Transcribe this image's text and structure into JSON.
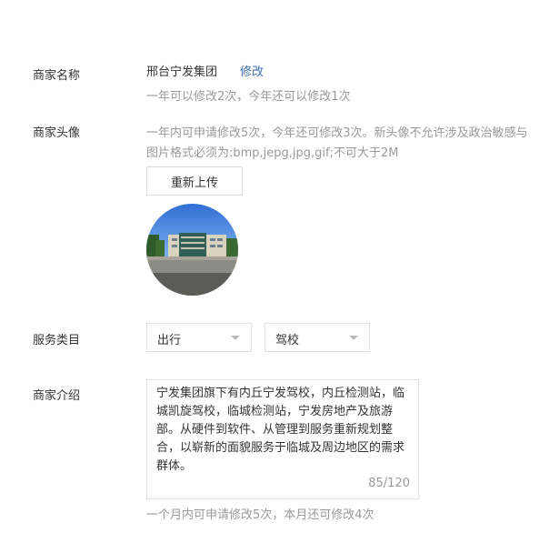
{
  "merchant_name": {
    "label": "商家名称",
    "value": "邢台宁发集团",
    "edit_label": "修改",
    "hint": "一年可以修改2次，今年还可以修改1次"
  },
  "merchant_avatar": {
    "label": "商家头像",
    "hint_line1": "一年内可申请修改5次，今年还可修改3次。新头像不允许涉及政治敏感与",
    "hint_line2": "图片格式必须为:bmp,jepg,jpg,gif;不可大于2M",
    "upload_label": "重新上传"
  },
  "service_category": {
    "label": "服务类目",
    "primary": "出行",
    "secondary": "驾校"
  },
  "merchant_intro": {
    "label": "商家介绍",
    "text": "宁发集团旗下有内丘宁发驾校，内丘检测站，临城凯旋驾校，临城检测站，宁发房地产及旅游部。从硬件到软件、从管理到服务重新规划整合，以崭新的面貌服务于临城及周边地区的需求群体。",
    "char_count": "85/120",
    "hint": "一个月内可申请修改5次，本月还可修改4次"
  }
}
